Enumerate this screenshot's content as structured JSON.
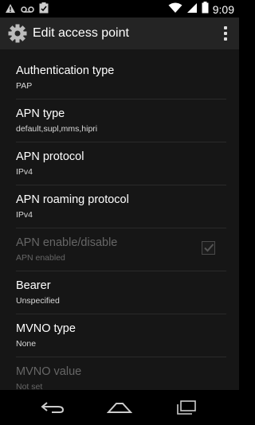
{
  "status_bar": {
    "time": "9:09",
    "left_icons": [
      "warning-icon",
      "voicemail-icon",
      "clipboard-check-icon"
    ],
    "right_icons": [
      "wifi-icon",
      "signal-icon",
      "battery-icon"
    ]
  },
  "action_bar": {
    "title": "Edit access point",
    "icon": "settings-gear-icon",
    "overflow_icon": "overflow-menu-icon"
  },
  "preferences": [
    {
      "title": "Authentication type",
      "summary": "PAP",
      "enabled": true
    },
    {
      "title": "APN type",
      "summary": "default,supl,mms,hipri",
      "enabled": true
    },
    {
      "title": "APN protocol",
      "summary": "IPv4",
      "enabled": true
    },
    {
      "title": "APN roaming protocol",
      "summary": "IPv4",
      "enabled": true
    },
    {
      "title": "APN enable/disable",
      "summary": "APN enabled",
      "enabled": false,
      "checked": true
    },
    {
      "title": "Bearer",
      "summary": "Unspecified",
      "enabled": true
    },
    {
      "title": "MVNO type",
      "summary": "None",
      "enabled": true
    },
    {
      "title": "MVNO value",
      "summary": "Not set",
      "enabled": false
    }
  ],
  "nav_bar": {
    "back": "back-icon",
    "home": "home-icon",
    "recents": "recents-icon"
  },
  "colors": {
    "status_bar": "#000000",
    "action_bar": "#242424",
    "content_bg": "#161616",
    "disabled_text": "#666666"
  }
}
